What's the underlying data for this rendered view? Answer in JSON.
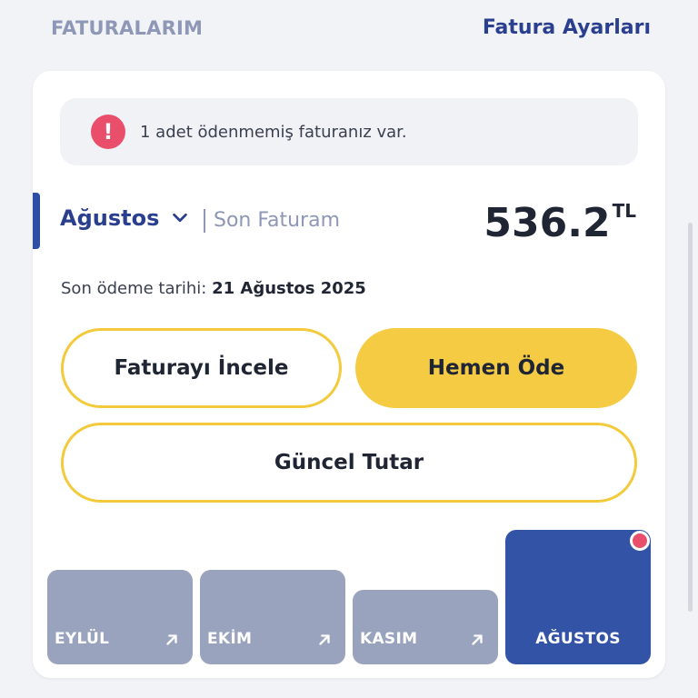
{
  "header": {
    "title": "FATURALARIM",
    "settings_link": "Fatura Ayarları"
  },
  "alert": {
    "icon": "exclamation-icon",
    "text": "1 adet ödenmemiş faturanız var."
  },
  "bill": {
    "month": "Ağustos",
    "last_bill_label": "Son Faturam",
    "amount": "536.2",
    "currency": "TL",
    "due_label": "Son ödeme tarihi:",
    "due_date": "21 Ağustos 2025"
  },
  "actions": {
    "review": "Faturayı İncele",
    "pay_now": "Hemen Öde",
    "current_amount": "Güncel Tutar"
  },
  "months": [
    {
      "label": "EYLÜL",
      "active": false
    },
    {
      "label": "EKİM",
      "active": false
    },
    {
      "label": "KASIM",
      "active": false
    },
    {
      "label": "AĞUSTOS",
      "active": true,
      "unpaid": true
    }
  ],
  "colors": {
    "primary": "#2b3f8f",
    "accent_yellow": "#f5cb44",
    "alert_red": "#e94e6b",
    "tile_inactive": "#9aa3bd",
    "tile_active": "#3353a7"
  }
}
